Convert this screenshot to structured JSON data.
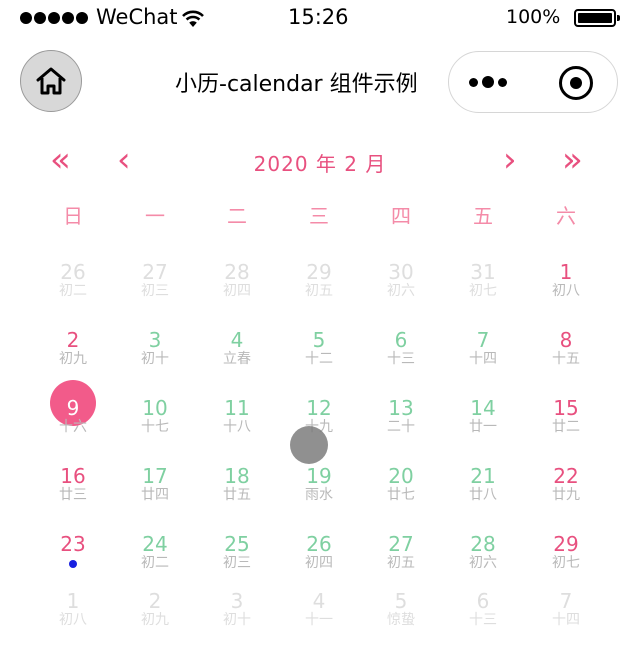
{
  "status_bar": {
    "carrier": "WeChat",
    "time": "15:26",
    "battery": "100%"
  },
  "nav": {
    "title": "小历-calendar 组件示例",
    "home_icon": "home-icon",
    "more_icon": "more-dots-icon",
    "close_icon": "target-circle-icon"
  },
  "calendar": {
    "title": "2020 年 2 月",
    "prev_year": "«",
    "prev_month": "‹",
    "next_month": "›",
    "next_year": "»",
    "weekdays": [
      "日",
      "一",
      "二",
      "三",
      "四",
      "五",
      "六"
    ],
    "accent": "#e8507f",
    "weekday_color": "#7fd0a1",
    "selected_bg": "#f25b8a",
    "mark_color": "#1820e0",
    "weeks": [
      [
        {
          "d": "26",
          "l": "初二",
          "in": false
        },
        {
          "d": "27",
          "l": "初三",
          "in": false
        },
        {
          "d": "28",
          "l": "初四",
          "in": false
        },
        {
          "d": "29",
          "l": "初五",
          "in": false
        },
        {
          "d": "30",
          "l": "初六",
          "in": false
        },
        {
          "d": "31",
          "l": "初七",
          "in": false
        },
        {
          "d": "1",
          "l": "初八",
          "in": true
        }
      ],
      [
        {
          "d": "2",
          "l": "初九",
          "in": true
        },
        {
          "d": "3",
          "l": "初十",
          "in": true
        },
        {
          "d": "4",
          "l": "立春",
          "in": true
        },
        {
          "d": "5",
          "l": "十二",
          "in": true
        },
        {
          "d": "6",
          "l": "十三",
          "in": true
        },
        {
          "d": "7",
          "l": "十四",
          "in": true
        },
        {
          "d": "8",
          "l": "十五",
          "in": true
        }
      ],
      [
        {
          "d": "9",
          "l": "十六",
          "in": true,
          "selected": true
        },
        {
          "d": "10",
          "l": "十七",
          "in": true
        },
        {
          "d": "11",
          "l": "十八",
          "in": true
        },
        {
          "d": "12",
          "l": "十九",
          "in": true
        },
        {
          "d": "13",
          "l": "二十",
          "in": true
        },
        {
          "d": "14",
          "l": "廿一",
          "in": true
        },
        {
          "d": "15",
          "l": "廿二",
          "in": true
        }
      ],
      [
        {
          "d": "16",
          "l": "廿三",
          "in": true
        },
        {
          "d": "17",
          "l": "廿四",
          "in": true
        },
        {
          "d": "18",
          "l": "廿五",
          "in": true
        },
        {
          "d": "19",
          "l": "雨水",
          "in": true
        },
        {
          "d": "20",
          "l": "廿七",
          "in": true
        },
        {
          "d": "21",
          "l": "廿八",
          "in": true
        },
        {
          "d": "22",
          "l": "廿九",
          "in": true
        }
      ],
      [
        {
          "d": "23",
          "l": "",
          "in": true,
          "mark": true
        },
        {
          "d": "24",
          "l": "初二",
          "in": true
        },
        {
          "d": "25",
          "l": "初三",
          "in": true
        },
        {
          "d": "26",
          "l": "初四",
          "in": true
        },
        {
          "d": "27",
          "l": "初五",
          "in": true
        },
        {
          "d": "28",
          "l": "初六",
          "in": true
        },
        {
          "d": "29",
          "l": "初七",
          "in": true
        }
      ],
      [
        {
          "d": "1",
          "l": "初八",
          "in": false
        },
        {
          "d": "2",
          "l": "初九",
          "in": false
        },
        {
          "d": "3",
          "l": "初十",
          "in": false
        },
        {
          "d": "4",
          "l": "十一",
          "in": false
        },
        {
          "d": "5",
          "l": "惊蛰",
          "in": false
        },
        {
          "d": "6",
          "l": "十三",
          "in": false
        },
        {
          "d": "7",
          "l": "十四",
          "in": false
        }
      ]
    ]
  }
}
